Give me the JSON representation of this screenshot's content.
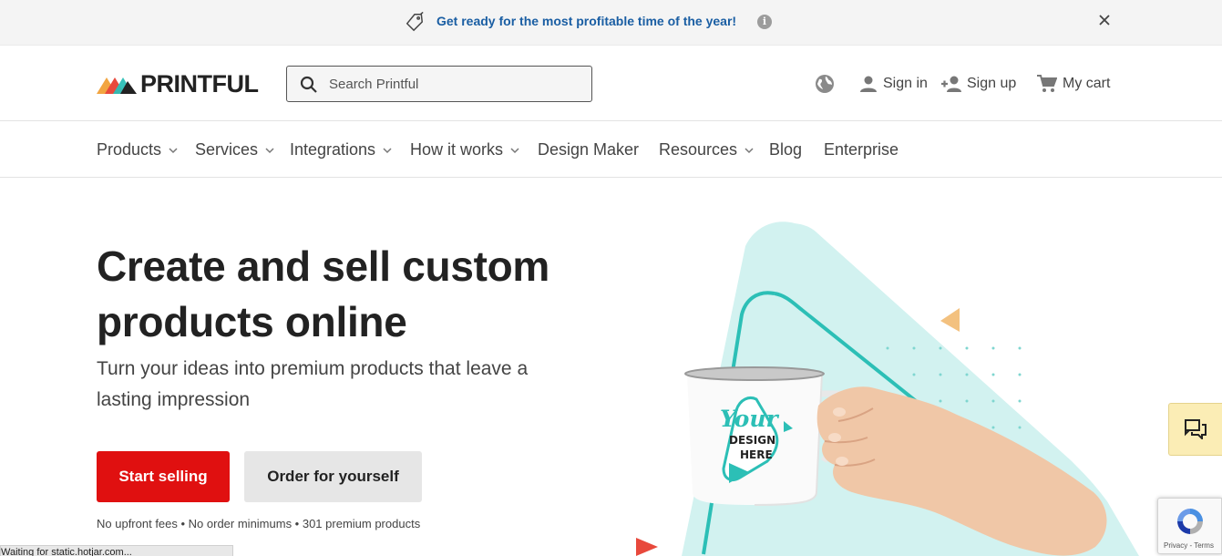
{
  "announcement": {
    "message": "Get ready for the most profitable time of the year!",
    "info_glyph": "i",
    "icons": [
      "price-tag-icon",
      "info-icon",
      "close-icon"
    ]
  },
  "header": {
    "logo_text": "PRINTFUL",
    "search_placeholder": "Search Printful",
    "search_value": "",
    "sign_in": "Sign in",
    "sign_up": "Sign up",
    "cart": "My cart"
  },
  "nav": {
    "items": [
      {
        "label": "Products",
        "dropdown": true
      },
      {
        "label": "Services",
        "dropdown": true
      },
      {
        "label": "Integrations",
        "dropdown": true
      },
      {
        "label": "How it works",
        "dropdown": true
      },
      {
        "label": "Design Maker",
        "dropdown": false
      },
      {
        "label": "Resources",
        "dropdown": true
      },
      {
        "label": "Blog",
        "dropdown": false
      },
      {
        "label": "Enterprise",
        "dropdown": false
      }
    ]
  },
  "hero": {
    "title": "Create and sell custom products online",
    "subtitle": "Turn your ideas into premium products that leave a lasting impression",
    "primary_button": "Start selling",
    "secondary_button": "Order for yourself",
    "fine_print": "No upfront fees • No order minimums • 301 premium products",
    "mug_text_1": "Your",
    "mug_text_2": "DESIGN",
    "mug_text_3": "HERE"
  },
  "recaptcha": {
    "links": "Privacy - Terms"
  },
  "status_bar": "Waiting for static.hotjar.com...",
  "colors": {
    "brand_red": "#e01010",
    "announce_blue": "#1a5ea3",
    "teal": "#2cbfb6",
    "mint": "#d2f2f0",
    "chat_bg": "#fbedb5"
  }
}
